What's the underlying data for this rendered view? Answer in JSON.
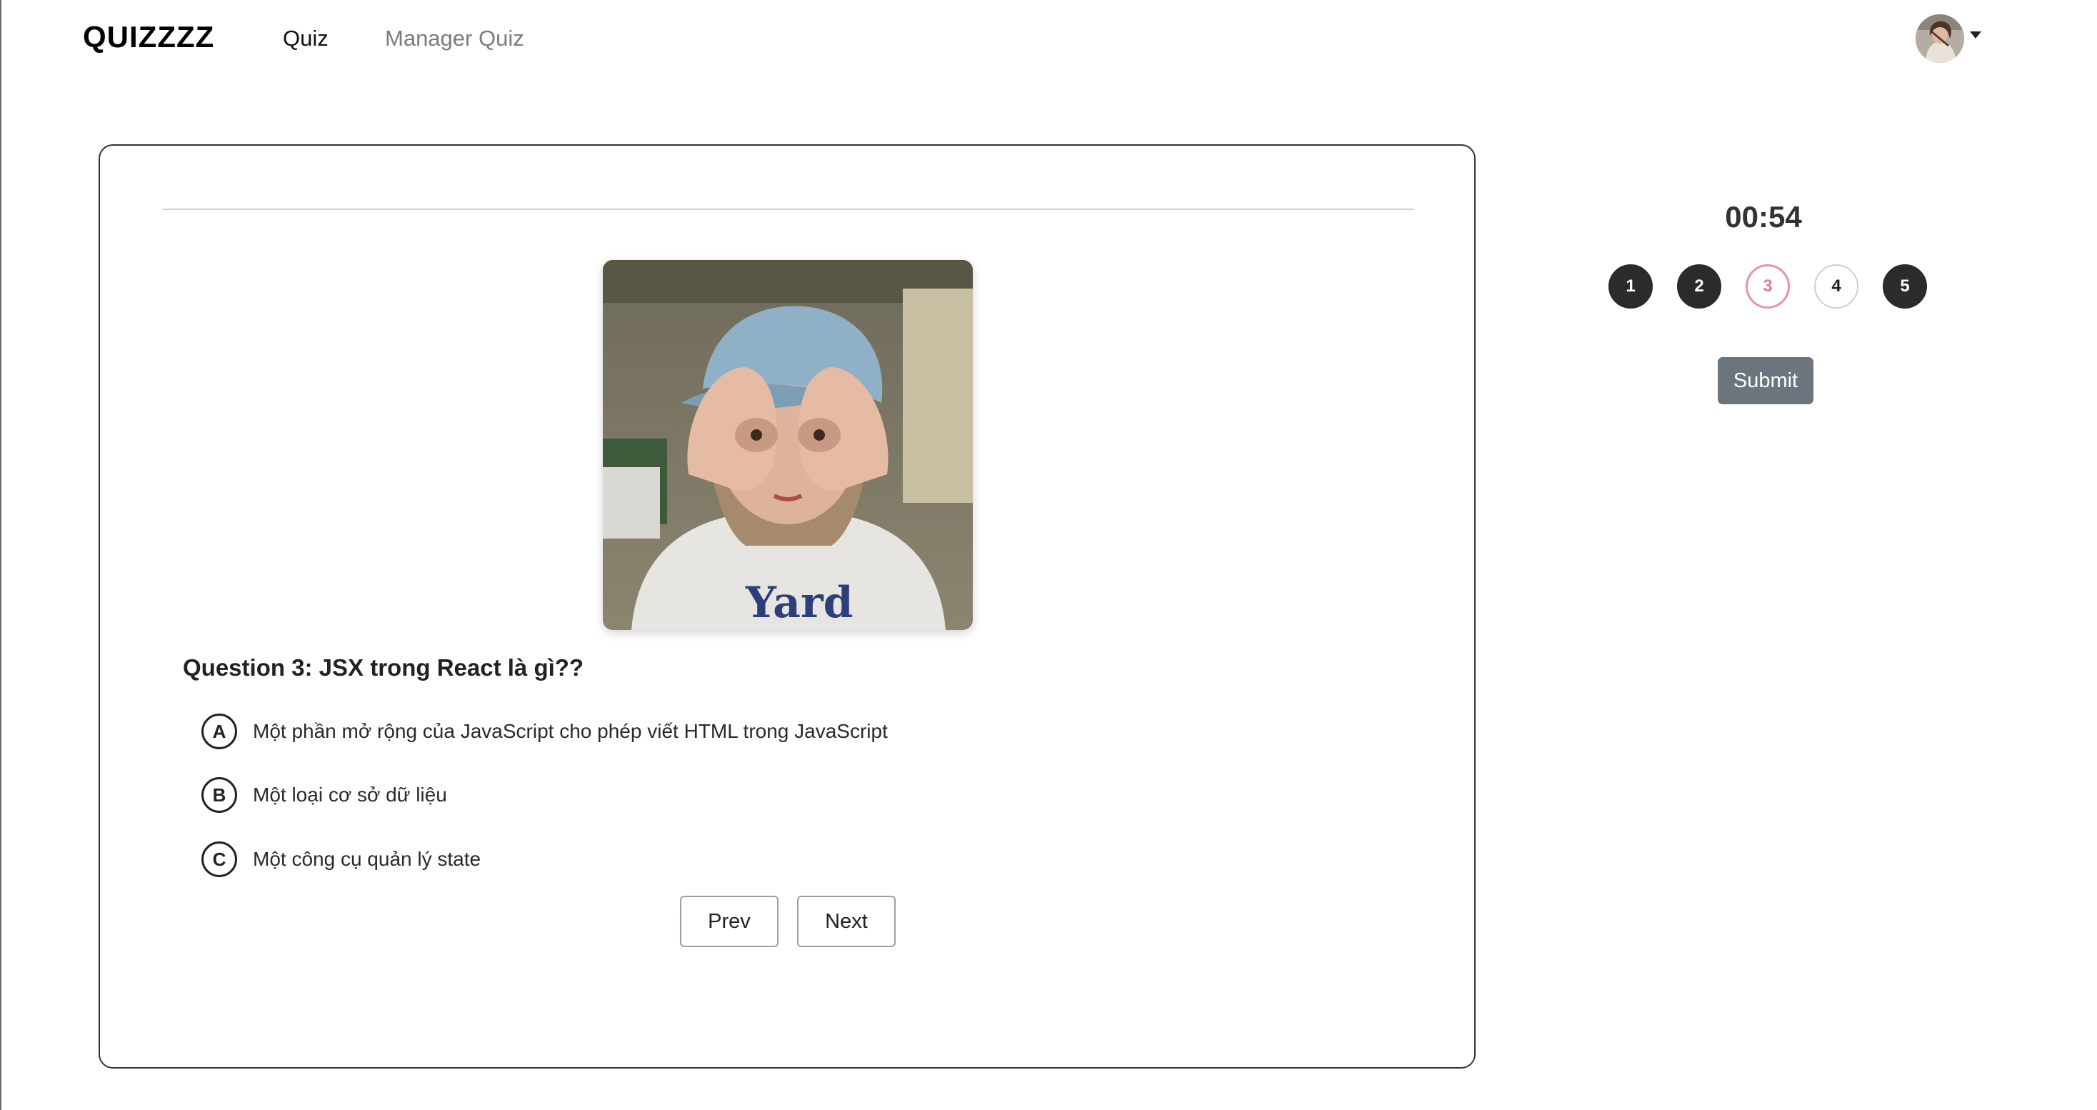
{
  "header": {
    "brand": "QUIZZZZ",
    "nav": {
      "quiz": "Quiz",
      "manager_quiz": "Manager Quiz"
    },
    "avatar_icon": "user-avatar-photo",
    "dropdown_icon": "caret-down-icon"
  },
  "quiz": {
    "image_icon": "question-photo",
    "question_title": "Question 3: JSX trong React là gì??",
    "answers": [
      {
        "letter": "A",
        "text": "Một phần mở rộng của JavaScript cho phép viết HTML trong JavaScript"
      },
      {
        "letter": "B",
        "text": "Một loại cơ sở dữ liệu"
      },
      {
        "letter": "C",
        "text": "Một công cụ quản lý state"
      }
    ],
    "prev_label": "Prev",
    "next_label": "Next"
  },
  "panel": {
    "timer": "00:54",
    "questions": [
      {
        "label": "1",
        "state": "answered"
      },
      {
        "label": "2",
        "state": "answered"
      },
      {
        "label": "3",
        "state": "current"
      },
      {
        "label": "4",
        "state": "unanswered"
      },
      {
        "label": "5",
        "state": "answered"
      }
    ],
    "submit_label": "Submit"
  },
  "colors": {
    "answered_dot": "#2b2b2b",
    "current_dot": "#e890b0",
    "submit_button": "#6c757d",
    "card_border": "#333333"
  }
}
